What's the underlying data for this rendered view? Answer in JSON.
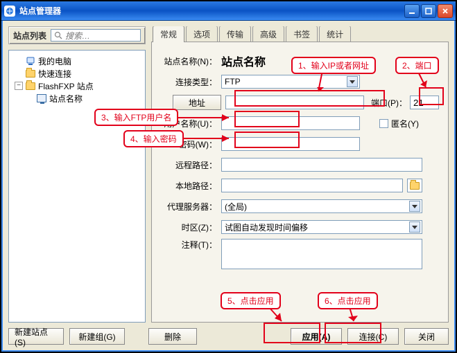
{
  "window": {
    "title": "站点管理器",
    "min": "Minimize",
    "max": "Maximize",
    "close": "Close"
  },
  "left": {
    "header": "站点列表",
    "search_placeholder": "搜索…",
    "nodes": {
      "mypc": "我的电脑",
      "quick": "快速连接",
      "flashfxp": "FlashFXP 站点",
      "sitename": "站点名称"
    }
  },
  "tabs": {
    "general": "常规",
    "options": "选项",
    "transfer": "传输",
    "advanced": "高级",
    "bookmarks": "书签",
    "stats": "统计"
  },
  "form": {
    "site_name_label": "站点名称(N)：",
    "site_name_value": "站点名称",
    "conn_type_label": "连接类型：",
    "conn_type_value": "FTP",
    "address_btn": "地址",
    "port_label": "端口(P)：",
    "port_value": "21",
    "user_label": "用户名称(U)：",
    "anon_label": "匿名(Y)",
    "pass_label": "密码(W)：",
    "remote_label": "远程路径：",
    "local_label": "本地路径：",
    "proxy_label": "代理服务器：",
    "proxy_value": "(全局)",
    "tz_label": "时区(Z)：",
    "tz_value": "试图自动发现时间偏移",
    "notes_label": "注释(T)："
  },
  "annotations": {
    "a1": "1、输入IP或者网址",
    "a2": "2、端口",
    "a3": "3、输入FTP用户名",
    "a4": "4、输入密码",
    "a5": "5、点击应用",
    "a6": "6、点击应用"
  },
  "buttons": {
    "new_site": "新建站点(S)",
    "new_group": "新建组(G)",
    "delete": "删除",
    "apply": "应用(A)",
    "connect": "连接(C)",
    "close": "关闭"
  }
}
